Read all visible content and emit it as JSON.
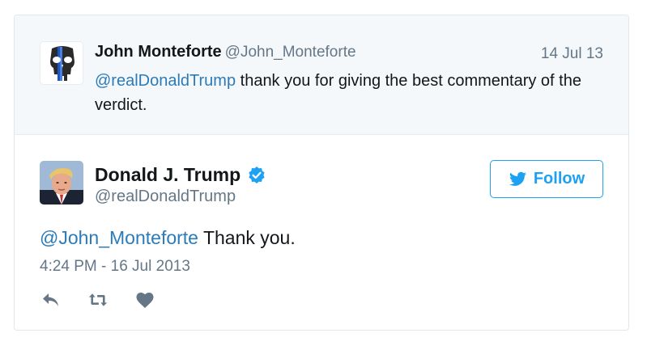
{
  "parent_tweet": {
    "name": "John Monteforte",
    "handle": "@John_Monteforte",
    "date": "14 Jul 13",
    "mention": "@realDonaldTrump",
    "text": " thank you for giving the best commentary of the verdict.",
    "avatar_icon": "punisher-skull-icon"
  },
  "main_tweet": {
    "name": "Donald J. Trump",
    "handle": "@realDonaldTrump",
    "verified_icon": "verified-badge-icon",
    "mention": "@John_Monteforte",
    "text": " Thank you.",
    "timestamp": "4:24 PM - 16 Jul 2013"
  },
  "follow_button": {
    "label": "Follow",
    "icon": "twitter-bird-icon"
  },
  "actions": {
    "reply_icon": "reply-icon",
    "retweet_icon": "retweet-icon",
    "like_icon": "heart-icon"
  },
  "colors": {
    "link": "#2b7bb9",
    "accent": "#1da1f2",
    "muted": "#657786",
    "text": "#14171a",
    "parent_bg": "#f5f8fa",
    "border": "#e1e8ed"
  }
}
